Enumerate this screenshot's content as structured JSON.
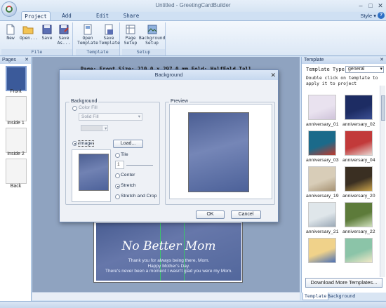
{
  "window": {
    "title": "Untitled - GreetingCardBuilder"
  },
  "tabs": [
    "Project",
    "Add Pieces",
    "Edit Pieces",
    "Share"
  ],
  "style_menu": "Style",
  "ribbon": {
    "file_group": {
      "label": "File",
      "buttons": [
        {
          "label": "New",
          "icon": "new-icon"
        },
        {
          "label": "Open...",
          "icon": "open-folder-icon"
        },
        {
          "label": "Save",
          "icon": "save-icon"
        },
        {
          "label": "Save\nAs...",
          "icon": "save-as-icon"
        }
      ]
    },
    "template_group": {
      "label": "Template",
      "buttons": [
        {
          "label": "Open\nTemplate",
          "icon": "open-template-icon"
        },
        {
          "label": "Save\nTemplate",
          "icon": "save-template-icon"
        }
      ]
    },
    "setup_group": {
      "label": "Setup",
      "buttons": [
        {
          "label": "Page\nSetup",
          "icon": "page-setup-icon"
        },
        {
          "label": "Background\nSetup",
          "icon": "background-setup-icon"
        }
      ]
    }
  },
  "pages_panel": {
    "title": "Pages",
    "pages": [
      "Front",
      "Inside 1",
      "Inside 2",
      "Back"
    ],
    "selected": "Front"
  },
  "workspace": {
    "page_info": "Page: Front   Size: 210.0 x 297.0 mm   Fold: HalfFold Tall",
    "card_headline": "No Better Mom",
    "card_lines": [
      "Thank you for always being there, Mom.",
      "Happy Mother's Day.",
      "There's never been a moment I wasn't glad you were my Mom."
    ]
  },
  "template_panel": {
    "title": "Template",
    "type_label": "Template Type",
    "type_value": "general",
    "hint": "Double click on template to apply it to project",
    "items": [
      {
        "name": "anniversary_01",
        "color": "#e9e2ef",
        "accent": "#cfc3da"
      },
      {
        "name": "anniversary_02",
        "color": "#1d2c63",
        "accent": "#3b4f93"
      },
      {
        "name": "anniversary_03",
        "color": "#1b6a8a",
        "accent": "#c0392b"
      },
      {
        "name": "anniversary_04",
        "color": "#c23a3a",
        "accent": "#e8d7d2"
      },
      {
        "name": "anniversary_19",
        "color": "#d8cdb8",
        "accent": "#a69273"
      },
      {
        "name": "anniversary_20",
        "color": "#3a2f22",
        "accent": "#c9a24b"
      },
      {
        "name": "anniversary_21",
        "color": "#dfe6ea",
        "accent": "#9aa8b6"
      },
      {
        "name": "anniversary_22",
        "color": "#5d7b3a",
        "accent": "#cfe0bb"
      },
      {
        "name": "",
        "color": "#f0d28a",
        "accent": "#4a6fb5"
      },
      {
        "name": "",
        "color": "#8bc4a8",
        "accent": "#f2e9c7"
      }
    ],
    "download_button": "Download More Templates...",
    "bottom_tabs": [
      "Template",
      "Background"
    ]
  },
  "dialog": {
    "title": "Background",
    "background_group": "Background",
    "color_fill_label": "Color Fill",
    "fill_type": "Solid Fill",
    "image_label": "Image",
    "load_button": "Load...",
    "tile_label": "Tile",
    "tile_value": "1",
    "center_label": "Center",
    "stretch_label": "Stretch",
    "stretch_crop_label": "Stretch and Crop",
    "preview_group": "Preview",
    "ok_button": "OK",
    "cancel_button": "Cancel"
  }
}
